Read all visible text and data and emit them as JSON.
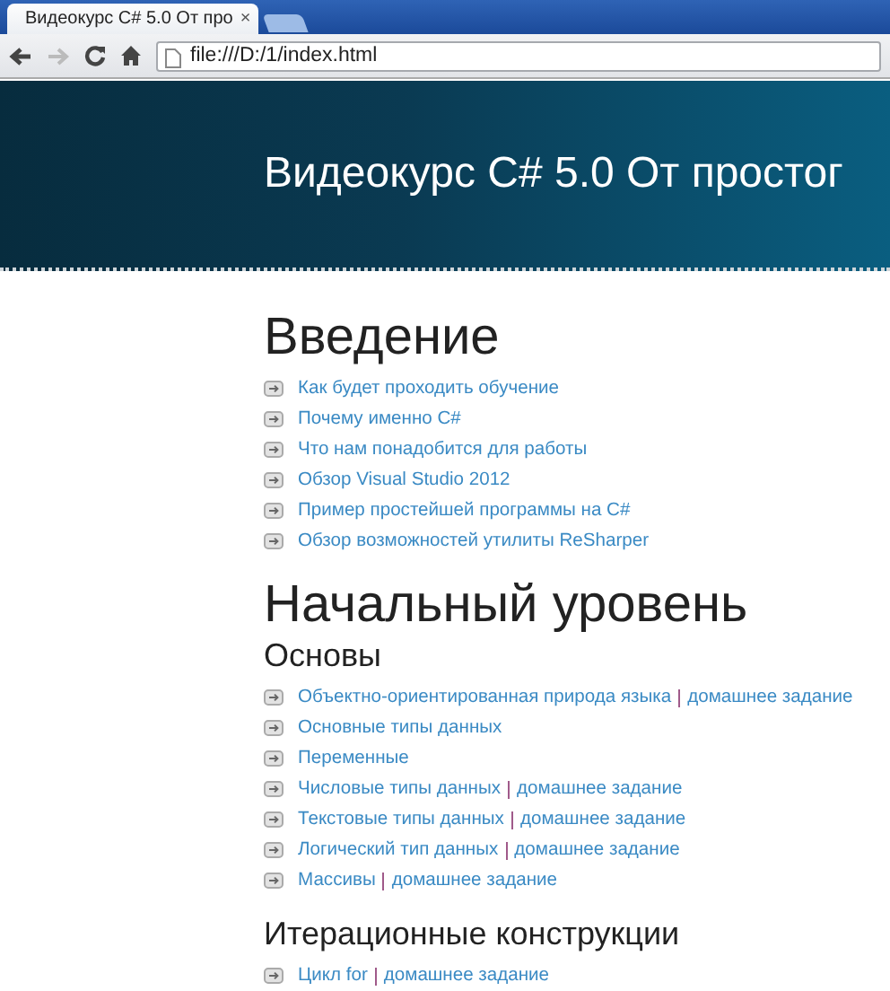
{
  "tab": {
    "title": "Видеокурс C# 5.0 От про",
    "close": "×"
  },
  "address": {
    "value": "file:///D:/1/index.html"
  },
  "banner": {
    "title": "Видеокурс C# 5.0 От простог"
  },
  "blocks": [
    {
      "kind": "h1",
      "text": "Введение"
    },
    {
      "kind": "list",
      "items": [
        {
          "links": [
            "Как будет проходить обучение"
          ]
        },
        {
          "links": [
            "Почему именно C#"
          ]
        },
        {
          "links": [
            "Что нам понадобится для работы"
          ]
        },
        {
          "links": [
            "Обзор Visual Studio 2012"
          ]
        },
        {
          "links": [
            "Пример простейшей программы на C#"
          ]
        },
        {
          "links": [
            "Обзор возможностей утилиты ReSharper"
          ]
        }
      ]
    },
    {
      "kind": "h1",
      "text": "Начальный уровень"
    },
    {
      "kind": "h2",
      "text": "Основы"
    },
    {
      "kind": "list",
      "items": [
        {
          "links": [
            "Объектно-ориентированная природа языка",
            "домашнее задание"
          ]
        },
        {
          "links": [
            "Основные типы данных"
          ]
        },
        {
          "links": [
            "Переменные"
          ]
        },
        {
          "links": [
            "Числовые типы данных",
            "домашнее задание"
          ]
        },
        {
          "links": [
            "Текстовые типы данных",
            "домашнее задание"
          ]
        },
        {
          "links": [
            "Логический тип данных",
            "домашнее задание"
          ]
        },
        {
          "links": [
            "Массивы",
            "домашнее задание"
          ]
        }
      ]
    },
    {
      "kind": "h2",
      "text": "Итерационные конструкции"
    },
    {
      "kind": "list",
      "items": [
        {
          "links": [
            "Цикл for",
            "домашнее задание"
          ]
        }
      ]
    }
  ]
}
